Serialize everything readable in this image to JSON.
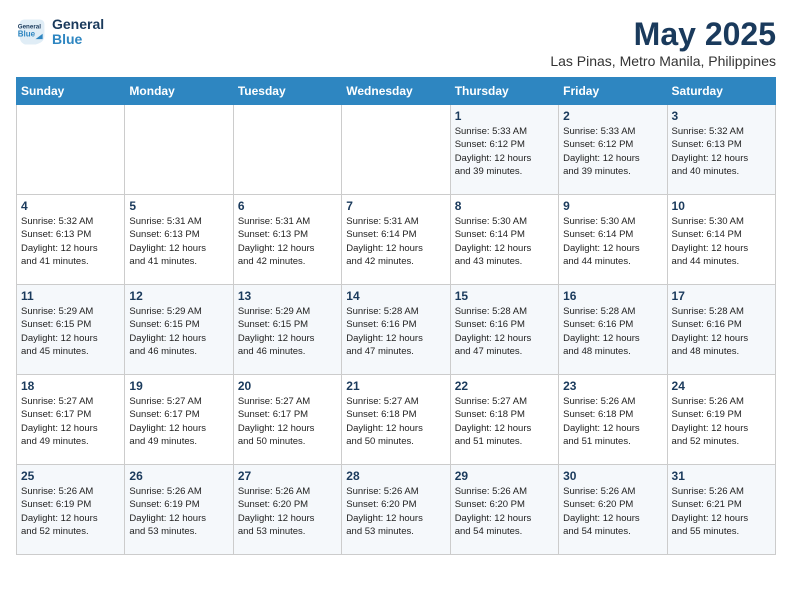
{
  "logo": {
    "line1": "General",
    "line2": "Blue"
  },
  "title": "May 2025",
  "subtitle": "Las Pinas, Metro Manila, Philippines",
  "days_of_week": [
    "Sunday",
    "Monday",
    "Tuesday",
    "Wednesday",
    "Thursday",
    "Friday",
    "Saturday"
  ],
  "weeks": [
    [
      {
        "day": "",
        "info": ""
      },
      {
        "day": "",
        "info": ""
      },
      {
        "day": "",
        "info": ""
      },
      {
        "day": "",
        "info": ""
      },
      {
        "day": "1",
        "info": "Sunrise: 5:33 AM\nSunset: 6:12 PM\nDaylight: 12 hours\nand 39 minutes."
      },
      {
        "day": "2",
        "info": "Sunrise: 5:33 AM\nSunset: 6:12 PM\nDaylight: 12 hours\nand 39 minutes."
      },
      {
        "day": "3",
        "info": "Sunrise: 5:32 AM\nSunset: 6:13 PM\nDaylight: 12 hours\nand 40 minutes."
      }
    ],
    [
      {
        "day": "4",
        "info": "Sunrise: 5:32 AM\nSunset: 6:13 PM\nDaylight: 12 hours\nand 41 minutes."
      },
      {
        "day": "5",
        "info": "Sunrise: 5:31 AM\nSunset: 6:13 PM\nDaylight: 12 hours\nand 41 minutes."
      },
      {
        "day": "6",
        "info": "Sunrise: 5:31 AM\nSunset: 6:13 PM\nDaylight: 12 hours\nand 42 minutes."
      },
      {
        "day": "7",
        "info": "Sunrise: 5:31 AM\nSunset: 6:14 PM\nDaylight: 12 hours\nand 42 minutes."
      },
      {
        "day": "8",
        "info": "Sunrise: 5:30 AM\nSunset: 6:14 PM\nDaylight: 12 hours\nand 43 minutes."
      },
      {
        "day": "9",
        "info": "Sunrise: 5:30 AM\nSunset: 6:14 PM\nDaylight: 12 hours\nand 44 minutes."
      },
      {
        "day": "10",
        "info": "Sunrise: 5:30 AM\nSunset: 6:14 PM\nDaylight: 12 hours\nand 44 minutes."
      }
    ],
    [
      {
        "day": "11",
        "info": "Sunrise: 5:29 AM\nSunset: 6:15 PM\nDaylight: 12 hours\nand 45 minutes."
      },
      {
        "day": "12",
        "info": "Sunrise: 5:29 AM\nSunset: 6:15 PM\nDaylight: 12 hours\nand 46 minutes."
      },
      {
        "day": "13",
        "info": "Sunrise: 5:29 AM\nSunset: 6:15 PM\nDaylight: 12 hours\nand 46 minutes."
      },
      {
        "day": "14",
        "info": "Sunrise: 5:28 AM\nSunset: 6:16 PM\nDaylight: 12 hours\nand 47 minutes."
      },
      {
        "day": "15",
        "info": "Sunrise: 5:28 AM\nSunset: 6:16 PM\nDaylight: 12 hours\nand 47 minutes."
      },
      {
        "day": "16",
        "info": "Sunrise: 5:28 AM\nSunset: 6:16 PM\nDaylight: 12 hours\nand 48 minutes."
      },
      {
        "day": "17",
        "info": "Sunrise: 5:28 AM\nSunset: 6:16 PM\nDaylight: 12 hours\nand 48 minutes."
      }
    ],
    [
      {
        "day": "18",
        "info": "Sunrise: 5:27 AM\nSunset: 6:17 PM\nDaylight: 12 hours\nand 49 minutes."
      },
      {
        "day": "19",
        "info": "Sunrise: 5:27 AM\nSunset: 6:17 PM\nDaylight: 12 hours\nand 49 minutes."
      },
      {
        "day": "20",
        "info": "Sunrise: 5:27 AM\nSunset: 6:17 PM\nDaylight: 12 hours\nand 50 minutes."
      },
      {
        "day": "21",
        "info": "Sunrise: 5:27 AM\nSunset: 6:18 PM\nDaylight: 12 hours\nand 50 minutes."
      },
      {
        "day": "22",
        "info": "Sunrise: 5:27 AM\nSunset: 6:18 PM\nDaylight: 12 hours\nand 51 minutes."
      },
      {
        "day": "23",
        "info": "Sunrise: 5:26 AM\nSunset: 6:18 PM\nDaylight: 12 hours\nand 51 minutes."
      },
      {
        "day": "24",
        "info": "Sunrise: 5:26 AM\nSunset: 6:19 PM\nDaylight: 12 hours\nand 52 minutes."
      }
    ],
    [
      {
        "day": "25",
        "info": "Sunrise: 5:26 AM\nSunset: 6:19 PM\nDaylight: 12 hours\nand 52 minutes."
      },
      {
        "day": "26",
        "info": "Sunrise: 5:26 AM\nSunset: 6:19 PM\nDaylight: 12 hours\nand 53 minutes."
      },
      {
        "day": "27",
        "info": "Sunrise: 5:26 AM\nSunset: 6:20 PM\nDaylight: 12 hours\nand 53 minutes."
      },
      {
        "day": "28",
        "info": "Sunrise: 5:26 AM\nSunset: 6:20 PM\nDaylight: 12 hours\nand 53 minutes."
      },
      {
        "day": "29",
        "info": "Sunrise: 5:26 AM\nSunset: 6:20 PM\nDaylight: 12 hours\nand 54 minutes."
      },
      {
        "day": "30",
        "info": "Sunrise: 5:26 AM\nSunset: 6:20 PM\nDaylight: 12 hours\nand 54 minutes."
      },
      {
        "day": "31",
        "info": "Sunrise: 5:26 AM\nSunset: 6:21 PM\nDaylight: 12 hours\nand 55 minutes."
      }
    ]
  ]
}
